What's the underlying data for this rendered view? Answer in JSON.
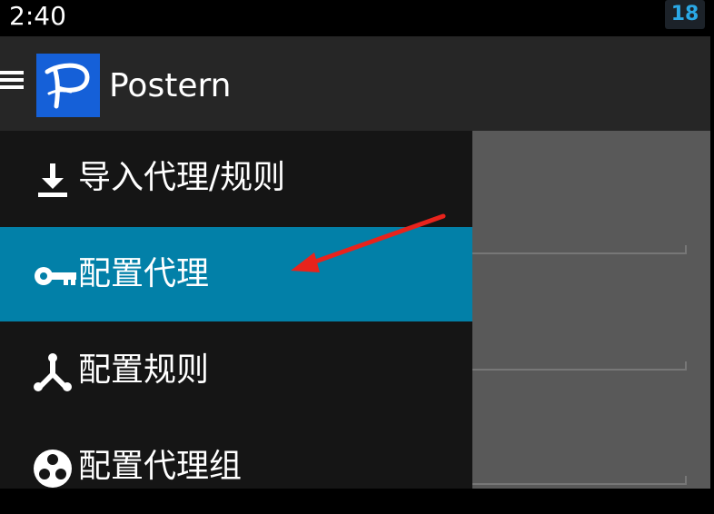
{
  "status_bar": {
    "time": "2:40",
    "notification_count": "18",
    "badge_color": "#2aa8e6"
  },
  "action_bar": {
    "menu_icon": "hamburger-menu-icon",
    "app_title": "Postern",
    "logo_icon": "postern-logo-icon",
    "logo_color": "#1560d8"
  },
  "drawer": {
    "items": [
      {
        "label": "导入代理/规则",
        "icon": "download-icon",
        "selected": false
      },
      {
        "label": "配置代理",
        "icon": "key-icon",
        "selected": true
      },
      {
        "label": "配置规则",
        "icon": "branch-icon",
        "selected": false
      },
      {
        "label": "配置代理组",
        "icon": "group-icon",
        "selected": false
      }
    ],
    "selected_color": "#0280a8"
  },
  "annotation": {
    "type": "red-arrow",
    "color": "#e8231c",
    "points_to": "配置代理"
  }
}
